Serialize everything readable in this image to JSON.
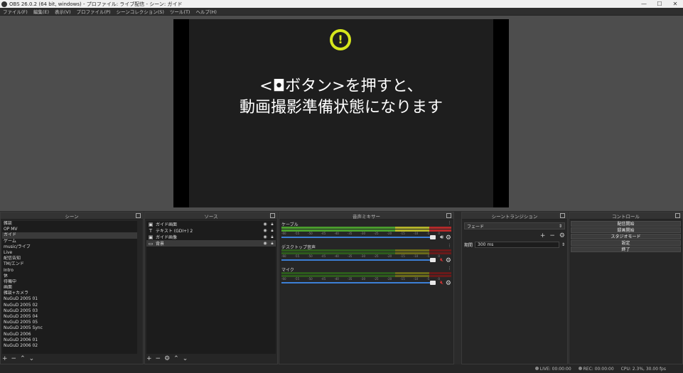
{
  "window": {
    "title": "OBS 26.0.2 (64 bit, windows) - プロファイル: ライブ配信 - シーン: ガイド"
  },
  "menu": [
    "ファイル(F)",
    "編集(E)",
    "表示(V)",
    "プロファイル(P)",
    "シーンコレクション(S)",
    "ツール(T)",
    "ヘルプ(H)"
  ],
  "preview": {
    "line1": "<◘ボタン>を押すと、",
    "line2": "動画撮影準備状態になります",
    "warning_glyph": "!"
  },
  "docks": {
    "scenes": {
      "title": "シーン",
      "items": [
        "雑談",
        "OP MV",
        "ガイド",
        "ゲーム",
        "music/ライブ",
        "Live",
        "配信告知",
        "TM/エンド",
        "Intro",
        "休",
        "待機中",
        "画面",
        "雑談+カメラ",
        "NuGuD 2005 01",
        "NuGuD 2005 02",
        "NuGuD 2005 03",
        "NuGuD 2005 04",
        "NuGuD 2005 05",
        "NuGuD 2005 Sync",
        "NuGuD 2006",
        "NuGuD 2006 01",
        "NuGuD 2006 02"
      ],
      "selected_index": 2
    },
    "sources": {
      "title": "ソース",
      "items": [
        {
          "icon": "image-icon",
          "glyph": "▣",
          "name": "ガイド画面"
        },
        {
          "icon": "text-icon",
          "glyph": "T",
          "name": "テキスト (GDI+) 2"
        },
        {
          "icon": "image-icon",
          "glyph": "▣",
          "name": "ガイド画像"
        },
        {
          "icon": "window-icon",
          "glyph": "▭",
          "name": "背景"
        }
      ],
      "selected_index": 3
    },
    "mixer": {
      "title": "音声ミキサー",
      "ticks": [
        "-60",
        "-55",
        "-50",
        "-45",
        "-40",
        "-35",
        "-30",
        "-25",
        "-20",
        "-15",
        "-10",
        "-5",
        "0"
      ],
      "channels": [
        {
          "label": "ケーブル",
          "muted": false,
          "active": true
        },
        {
          "label": "デスクトップ音声",
          "muted": true,
          "active": false
        },
        {
          "label": "マイク",
          "muted": true,
          "active": false
        }
      ]
    },
    "transitions": {
      "title": "シーントランジション",
      "selected": "フェード",
      "duration_label": "期間",
      "duration_value": "300 ms"
    },
    "controls": {
      "title": "コントロール",
      "buttons": [
        "配信開始",
        "録画開始",
        "スタジオモード",
        "設定",
        "終了"
      ]
    }
  },
  "status": {
    "live": "LIVE: 00:00:00",
    "rec": "REC: 00:00:00",
    "cpu": "CPU: 2.3%, 30.00 fps"
  }
}
